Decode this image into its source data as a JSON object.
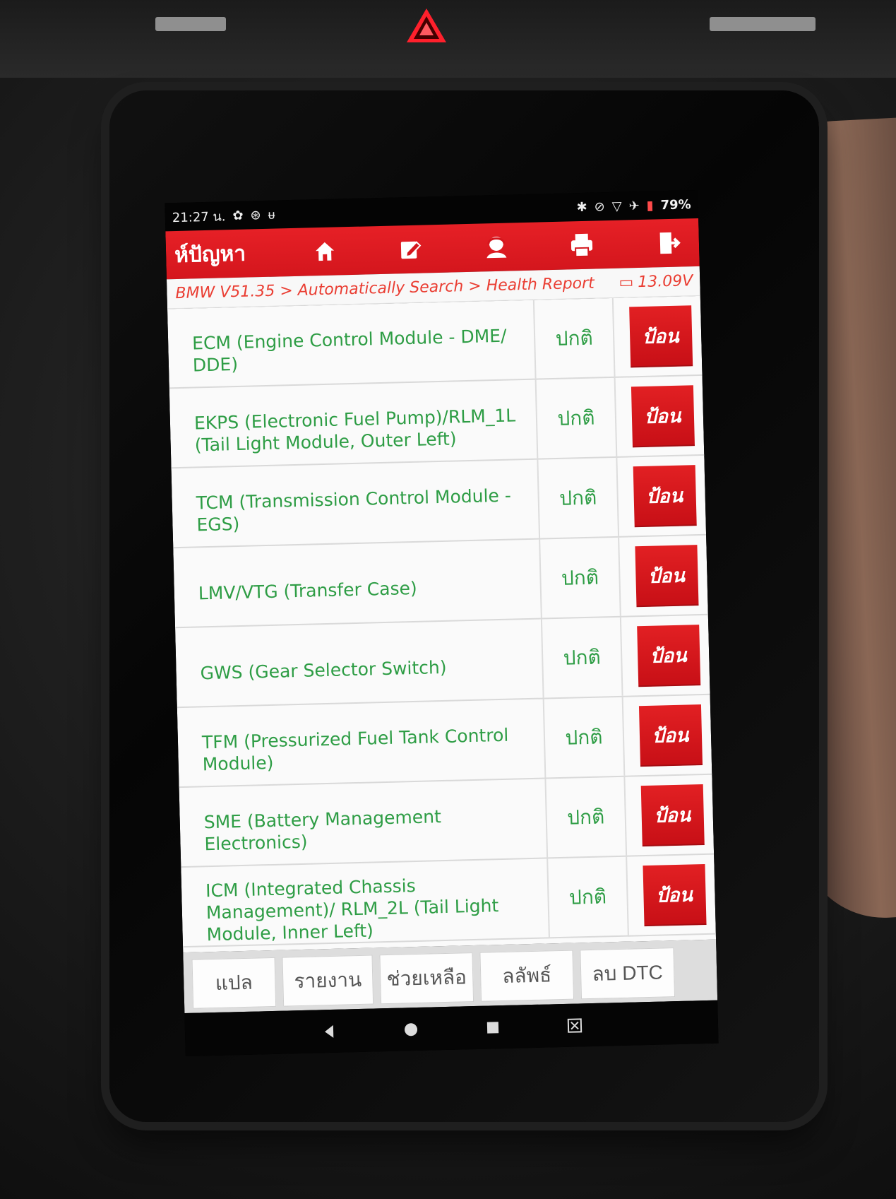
{
  "device": {
    "status_bar": {
      "time": "21:27 น.",
      "battery": "79%"
    },
    "toolbar": {
      "title": "ห์ปัญหา",
      "icons": [
        {
          "name": "home-icon"
        },
        {
          "name": "edit-icon"
        },
        {
          "name": "user-icon"
        },
        {
          "name": "print-icon"
        },
        {
          "name": "exit-icon"
        }
      ]
    },
    "breadcrumb": {
      "path": "BMW V51.35 > Automatically Search > Health Report",
      "voltage": "13.09V"
    },
    "modules": [
      {
        "name": "ECM (Engine Control Module - DME/ DDE)",
        "status": "ปกติ",
        "action": "ป้อน"
      },
      {
        "name": "EKPS (Electronic Fuel Pump)/RLM_1L (Tail Light Module, Outer Left)",
        "status": "ปกติ",
        "action": "ป้อน"
      },
      {
        "name": "TCM (Transmission Control Module - EGS)",
        "status": "ปกติ",
        "action": "ป้อน"
      },
      {
        "name": "LMV/VTG (Transfer Case)",
        "status": "ปกติ",
        "action": "ป้อน"
      },
      {
        "name": "GWS (Gear Selector Switch)",
        "status": "ปกติ",
        "action": "ป้อน"
      },
      {
        "name": "TFM (Pressurized Fuel Tank Control Module)",
        "status": "ปกติ",
        "action": "ป้อน"
      },
      {
        "name": "SME (Battery Management Electronics)",
        "status": "ปกติ",
        "action": "ป้อน"
      },
      {
        "name": "ICM (Integrated Chassis Management)/ RLM_2L (Tail Light Module, Inner Left)",
        "status": "ปกติ",
        "action": "ป้อน"
      }
    ],
    "bottom_buttons": [
      {
        "label": "แปล"
      },
      {
        "label": "รายงาน"
      },
      {
        "label": "ช่วยเหลือ"
      },
      {
        "label": "ลลัพธ์"
      },
      {
        "label": "ลบ DTC"
      }
    ],
    "nav_icons": [
      {
        "name": "back-icon"
      },
      {
        "name": "home-circle-icon"
      },
      {
        "name": "recents-icon"
      },
      {
        "name": "screenshot-icon"
      }
    ]
  }
}
